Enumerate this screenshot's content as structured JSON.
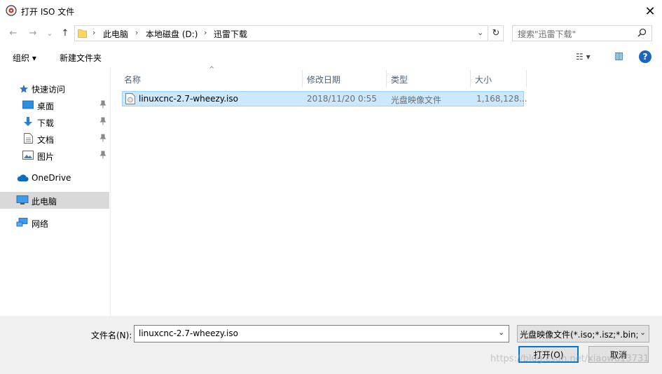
{
  "window": {
    "title": "打开 ISO 文件",
    "close_glyph": "✕"
  },
  "nav": {
    "back_glyph": "←",
    "forward_glyph": "→",
    "recent_glyph": "⌄",
    "up_glyph": "↑",
    "breadcrumb": [
      "此电脑",
      "本地磁盘 (D:)",
      "迅雷下载"
    ],
    "separator": "›",
    "dropdown_glyph": "⌄",
    "refresh_glyph": "↻",
    "search_placeholder": "搜索\"迅雷下载\"",
    "search_glyph": "⚲"
  },
  "toolbar": {
    "organize": "组织 ▾",
    "new_folder": "新建文件夹",
    "view_glyph": "☷ ▾",
    "pane_glyph": "▥",
    "help_glyph": "?"
  },
  "sidebar": {
    "quick_access": "快速访问",
    "items": [
      {
        "label": "桌面",
        "icon": "desktop-icon"
      },
      {
        "label": "下载",
        "icon": "download-icon"
      },
      {
        "label": "文档",
        "icon": "document-icon"
      },
      {
        "label": "图片",
        "icon": "picture-icon"
      }
    ],
    "pin_glyph": "📌",
    "onedrive": "OneDrive",
    "this_pc": "此电脑",
    "network": "网络"
  },
  "columns": {
    "name": "名称",
    "date": "修改日期",
    "type": "类型",
    "size": "大小",
    "sort_glyph": "^"
  },
  "files": [
    {
      "name": "linuxcnc-2.7-wheezy.iso",
      "date": "2018/11/20 0:55",
      "type": "光盘映像文件",
      "size": "1,168,128..."
    }
  ],
  "footer": {
    "filename_label": "文件名(N):",
    "filename_value": "linuxcnc-2.7-wheezy.iso",
    "filter_value": "光盘映像文件(*.iso;*.isz;*.bin;*",
    "open_button": "打开(O)",
    "cancel_button": "取消",
    "watermark": "https://blog.csdn.net/xiaowu13731"
  },
  "colors": {
    "accent": "#0078d7",
    "selection": "#cce8ff",
    "selection_border": "#99d1ff",
    "header_text": "#4c607a"
  }
}
